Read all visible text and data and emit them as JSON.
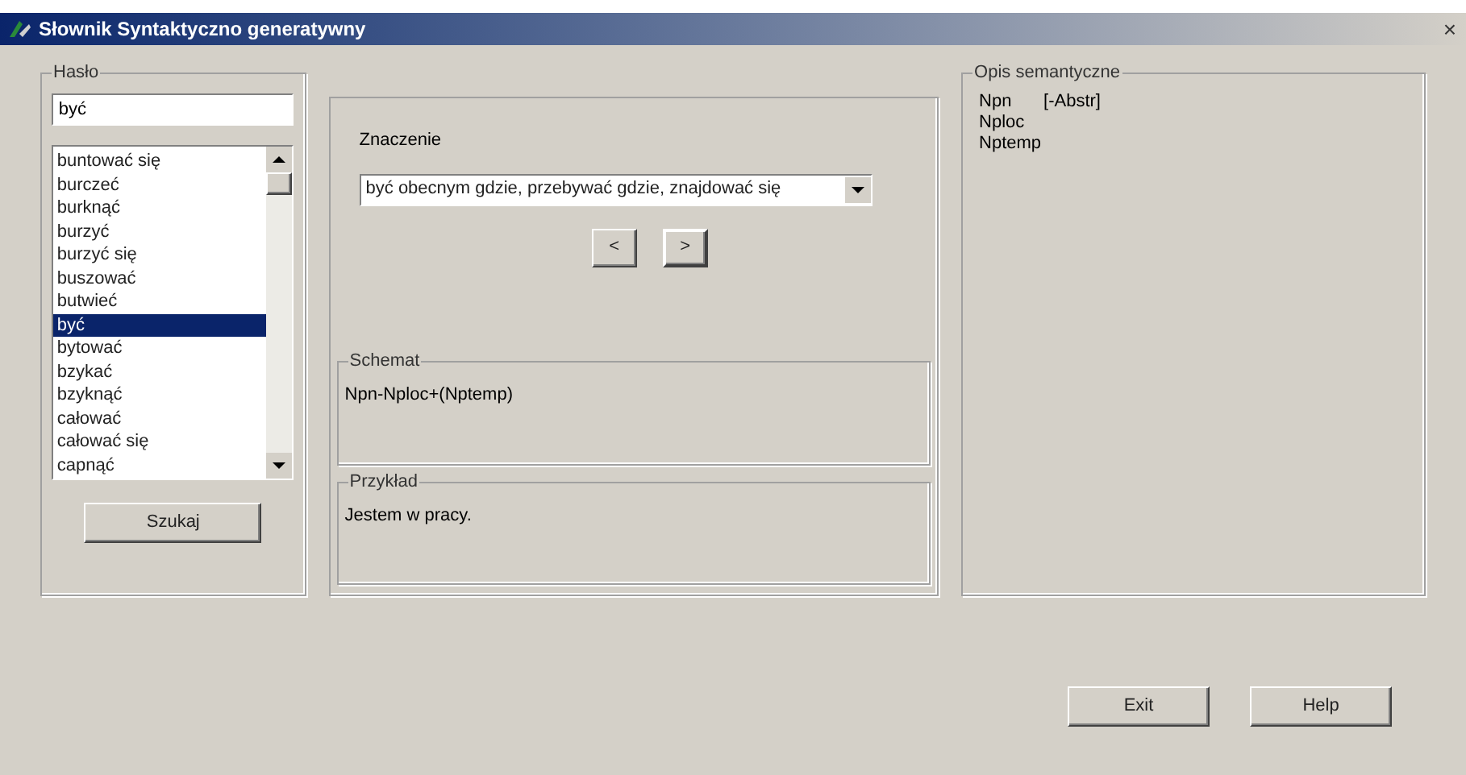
{
  "window": {
    "title": "Słownik Syntaktyczno generatywny",
    "close": "×"
  },
  "haslo": {
    "label": "Hasło",
    "value": "być",
    "items": [
      {
        "text": "buntować się",
        "selected": false
      },
      {
        "text": "burczeć",
        "selected": false
      },
      {
        "text": "burknąć",
        "selected": false
      },
      {
        "text": "burzyć",
        "selected": false
      },
      {
        "text": "burzyć się",
        "selected": false
      },
      {
        "text": "buszować",
        "selected": false
      },
      {
        "text": "butwieć",
        "selected": false
      },
      {
        "text": "być",
        "selected": true
      },
      {
        "text": "bytować",
        "selected": false
      },
      {
        "text": "bzykać",
        "selected": false
      },
      {
        "text": "bzyknąć",
        "selected": false
      },
      {
        "text": "całować",
        "selected": false
      },
      {
        "text": "całować się",
        "selected": false
      },
      {
        "text": "capnąć",
        "selected": false
      }
    ],
    "search_button": "Szukaj"
  },
  "znaczenie": {
    "label": "Znaczenie",
    "value": "być obecnym gdzie, przebywać gdzie, znajdować się",
    "prev": "<",
    "next": ">"
  },
  "schemat": {
    "label": "Schemat",
    "text": "Npn-Nploc+(Nptemp)"
  },
  "przyklad": {
    "label": "Przykład",
    "text": "Jestem w pracy."
  },
  "opis": {
    "label": "Opis semantyczne",
    "rows": [
      {
        "name": "Npn",
        "value": "[-Abstr]"
      },
      {
        "name": "Nploc"
      },
      {
        "name": "Nptemp"
      }
    ]
  },
  "buttons": [
    "Exit",
    "Help"
  ]
}
